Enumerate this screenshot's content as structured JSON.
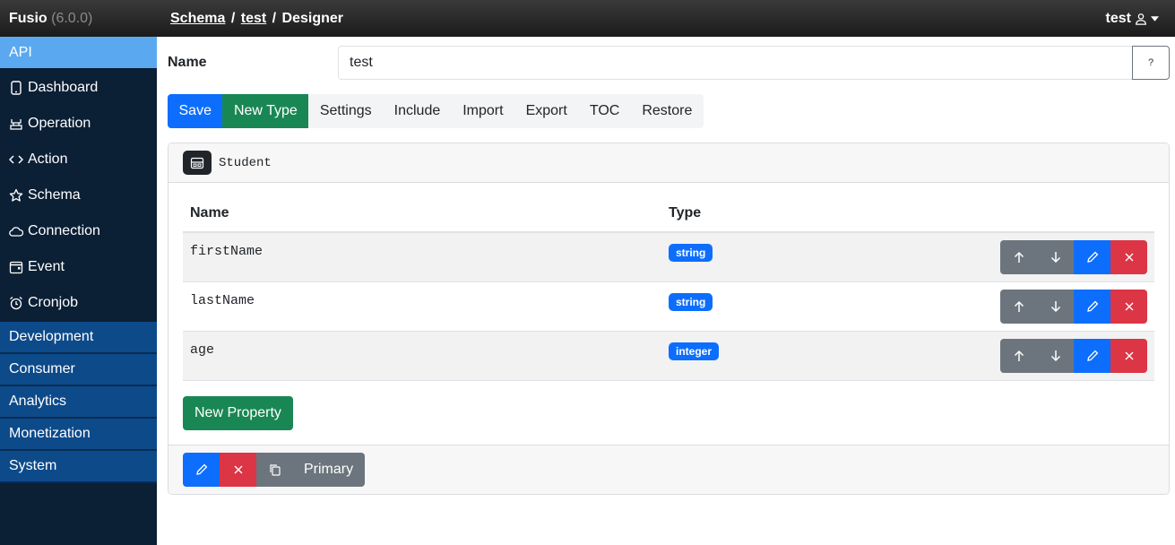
{
  "app": {
    "name": "Fusio",
    "version": "(6.0.0)"
  },
  "breadcrumb": {
    "schema": "Schema",
    "sep1": "/",
    "item": "test",
    "sep2": "/",
    "page": "Designer"
  },
  "user": {
    "name": "test",
    "icon": "person-icon",
    "caret": "caret-down-icon"
  },
  "sidebar": {
    "active_group": "API",
    "items": [
      {
        "label": "Dashboard",
        "icon": "tablet-icon"
      },
      {
        "label": "Operation",
        "icon": "cable-icon"
      },
      {
        "label": "Action",
        "icon": "code-icon"
      },
      {
        "label": "Schema",
        "icon": "star-icon"
      },
      {
        "label": "Connection",
        "icon": "cloud-icon"
      },
      {
        "label": "Event",
        "icon": "calendar-icon"
      },
      {
        "label": "Cronjob",
        "icon": "alarm-icon"
      }
    ],
    "groups": [
      "Development",
      "Consumer",
      "Analytics",
      "Monetization",
      "System"
    ]
  },
  "form": {
    "name_label": "Name",
    "name_value": "test",
    "help_label": "?"
  },
  "toolbar": {
    "save": "Save",
    "new_type": "New Type",
    "settings": "Settings",
    "include": "Include",
    "import": "Import",
    "export": "Export",
    "toc": "TOC",
    "restore": "Restore"
  },
  "type_card": {
    "type_name": "Student",
    "columns": {
      "name": "Name",
      "type": "Type"
    },
    "properties": [
      {
        "name": "firstName",
        "type": "string"
      },
      {
        "name": "lastName",
        "type": "string"
      },
      {
        "name": "age",
        "type": "integer"
      }
    ],
    "new_property": "New Property",
    "primary_label": "Primary"
  },
  "colors": {
    "primary": "#0d6efd",
    "success": "#198754",
    "danger": "#dc3545",
    "secondary": "#6c757d",
    "sidebar": "#0b1f35",
    "active": "#5aa9f0"
  }
}
